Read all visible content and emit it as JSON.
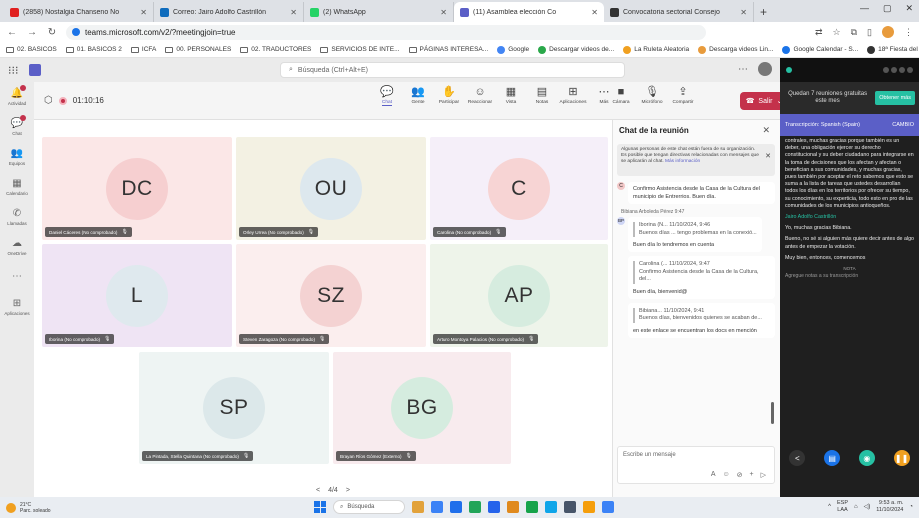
{
  "browser": {
    "tabs": [
      {
        "label": "(2858) Nostalgia Chanseno No",
        "color": "#e02020",
        "active": false
      },
      {
        "label": "Correo: Jairo Adolfo Castrillón",
        "color": "#0f6cbd",
        "active": false
      },
      {
        "label": "(2) WhatsApp",
        "color": "#25d366",
        "active": false
      },
      {
        "label": "(11) Asamblea elección Co",
        "color": "#5b5fc7",
        "active": true
      },
      {
        "label": "Convocatoria sectorial Consejo",
        "color": "#333333",
        "active": false
      }
    ],
    "url": "teams.microsoft.com/v2/?meetingjoin=true",
    "bookmarks": [
      {
        "label": "02. BASICOS",
        "type": "folder"
      },
      {
        "label": "01. BASICOS 2",
        "type": "folder"
      },
      {
        "label": "ICFA",
        "type": "folder"
      },
      {
        "label": "00. PERSONALES",
        "type": "folder"
      },
      {
        "label": "02. TRADUCTORES",
        "type": "folder"
      },
      {
        "label": "SERVICIOS DE INTE...",
        "type": "folder"
      },
      {
        "label": "PÁGINAS INTERESA...",
        "type": "folder"
      },
      {
        "label": "Google",
        "type": "site",
        "color": "#4285f4"
      },
      {
        "label": "Descargar videos de...",
        "type": "site",
        "color": "#2aa84a"
      },
      {
        "label": "La Ruleta Aleatoria",
        "type": "site",
        "color": "#f0a020"
      },
      {
        "label": "Descarga videos Lin...",
        "type": "site",
        "color": "#e89b3c"
      },
      {
        "label": "Google Calendar - S...",
        "type": "site",
        "color": "#1a73e8"
      },
      {
        "label": "18ª Fiesta del Libro...",
        "type": "site",
        "color": "#333333"
      },
      {
        "label": "(4350) Nostalgia Ch...",
        "type": "site",
        "color": "#e02020"
      }
    ]
  },
  "teams": {
    "search_placeholder": "Búsqueda (Ctrl+Alt+E)",
    "rail": [
      {
        "label": "Actividad",
        "icon": "bell-icon",
        "glyph": "🔔"
      },
      {
        "label": "Chat",
        "icon": "chat-icon",
        "glyph": "💬"
      },
      {
        "label": "Equipos",
        "icon": "teams-icon",
        "glyph": "👥"
      },
      {
        "label": "Calendario",
        "icon": "calendar-icon",
        "glyph": "▦"
      },
      {
        "label": "Llamadas",
        "icon": "phone-icon",
        "glyph": "✆"
      },
      {
        "label": "OneDrive",
        "icon": "cloud-icon",
        "glyph": "☁"
      },
      {
        "label": "...",
        "icon": "more-icon",
        "glyph": "⋯"
      },
      {
        "label": "Aplicaciones",
        "icon": "apps-icon",
        "glyph": "⊞"
      }
    ],
    "meeting": {
      "timer": "01:10:16",
      "toolbar": [
        {
          "label": "Chat",
          "icon": "chat-icon",
          "glyph": "💬",
          "active": true
        },
        {
          "label": "Gente",
          "icon": "people-icon",
          "glyph": "👥"
        },
        {
          "label": "Participar",
          "icon": "raise-hand-icon",
          "glyph": "✋"
        },
        {
          "label": "Reaccionar",
          "icon": "react-icon",
          "glyph": "☺"
        },
        {
          "label": "Vista",
          "icon": "view-icon",
          "glyph": "▦"
        },
        {
          "label": "Notas",
          "icon": "notes-icon",
          "glyph": "▤"
        },
        {
          "label": "Aplicaciones",
          "icon": "apps-icon",
          "glyph": "⊞"
        },
        {
          "label": "Más",
          "icon": "more-icon",
          "glyph": "⋯"
        }
      ],
      "devices": [
        {
          "label": "Cámara",
          "icon": "camera-icon",
          "glyph": "■"
        },
        {
          "label": "Micrófono",
          "icon": "mic-icon",
          "glyph": "🎙"
        },
        {
          "label": "Compartir",
          "icon": "share-icon",
          "glyph": "⇪"
        }
      ],
      "leave_label": "Salir",
      "pager": "4/4",
      "participants": [
        {
          "initials": "DC",
          "name": "Daniel Cáceres (No comprobado)",
          "bg": "#fbe7e7",
          "circle": "#f6cfd0"
        },
        {
          "initials": "OU",
          "name": "Orley Urrea (No comprobado)",
          "bg": "#f3f1e3",
          "circle": "#dde8ee"
        },
        {
          "initials": "C",
          "name": "Carolina (No comprobado)",
          "bg": "#f5eff9",
          "circle": "#f7d4d4"
        },
        {
          "initials": "L",
          "name": "Iborina (No comprobado)",
          "bg": "#efe4f4",
          "circle": "#dfe9ee"
        },
        {
          "initials": "SZ",
          "name": "Steven Zaragoza (No comprobado)",
          "bg": "#fbeeee",
          "circle": "#f4d2d2"
        },
        {
          "initials": "AP",
          "name": "Arturo Montoya Palacios (No comprobado)",
          "bg": "#eef4ea",
          "circle": "#d6ecdf"
        },
        {
          "initials": "SP",
          "name": "La Pintada, Stella Quintana (No comprobado)",
          "bg": "#eef4f3",
          "circle": "#dce8ea"
        },
        {
          "initials": "BG",
          "name": "Brayan Ríos Gómez (Externo)",
          "bg": "#f8ebee",
          "circle": "#d5ecdf"
        }
      ]
    },
    "chat": {
      "title": "Chat de la reunión",
      "notice": "Algunas personas de este chat están fuera de su organización. Es posible que tengan directivas relacionadas con mensajes que se aplicarán al chat.",
      "notice_link": "Más información",
      "msg1": "Confirmo Asistencia desde la Casa de la Cultura del municipio de Entrerrios. Buen día.",
      "msg2_sender": "Bibiana Arboleda Pérez 9:47",
      "msg2_reply_head": "Iborina (N...   11/10/2024, 9:46",
      "msg2_reply_body": "Buenos días ... tengo problemas en la conexió...",
      "msg2_text": "Buen día lo tendremos en cuenta",
      "msg3_reply_head": "Carolina (...  11/10/2024, 9:47",
      "msg3_reply_body": "Confirmo Asistencia desde la Casa de la Cultura, del...",
      "msg3_text": "Buen día, bienvenid@",
      "msg4_reply_head": "Bibiana...    11/10/2024, 9:41",
      "msg4_reply_body": "Buenos días, bienvenidos quienes se acaban de...",
      "msg4_text": "en este enlace se encuentran los docs en mención",
      "compose_placeholder": "Escribe un mensaje"
    }
  },
  "side_panel": {
    "promo_text": "Quedan 7 reuniones gratuitas este mes",
    "promo_button": "Obtener más",
    "trans_label": "Transcripción: Spanish (Spain)",
    "trans_change": "CAMBIO",
    "paragraph1": "contrales, muchas gracias porque también es un deber, una obligación ejercer su derecho constitucional y su deber ciudadano para integrarse en la toma de decisiones que los afectan y afectan o benefician a sus comunidades, y muchas gracias, pues también por aceptar el reto sabemos que esto se suma a la lista de tareas que ustedes desarrollan todos los días en los territorios por ofrecer su tiempo, su conocimiento, su experticia, todo esto en pro de las comunidades de los municipios antioqueños.",
    "speaker": "Jairo Adolfo Castrillón",
    "paragraph2": "Yo, muchas gracias Bibiana.",
    "paragraph3": "Bueno, no sé si alguien más quiere decir antes de algo antes de empezar la votación.",
    "paragraph4": "Muy bien, entonces, comencemos",
    "notes_label": "NOTA",
    "add_note": "Agregue notas a su transcripción"
  },
  "taskbar": {
    "temp": "21°C",
    "weather": "Parc. soleado",
    "search": "Búsqueda",
    "lang": "ESP",
    "lang2": "LAA",
    "time": "9:53 a. m.",
    "date": "11/10/2024",
    "apps": [
      "#e2a23b",
      "#3b82f6",
      "#1f6feb",
      "#22a559",
      "#2563eb",
      "#e08a1e",
      "#16a34a",
      "#0ea5e9",
      "#475569",
      "#f59e0b",
      "#3b82f6"
    ]
  }
}
